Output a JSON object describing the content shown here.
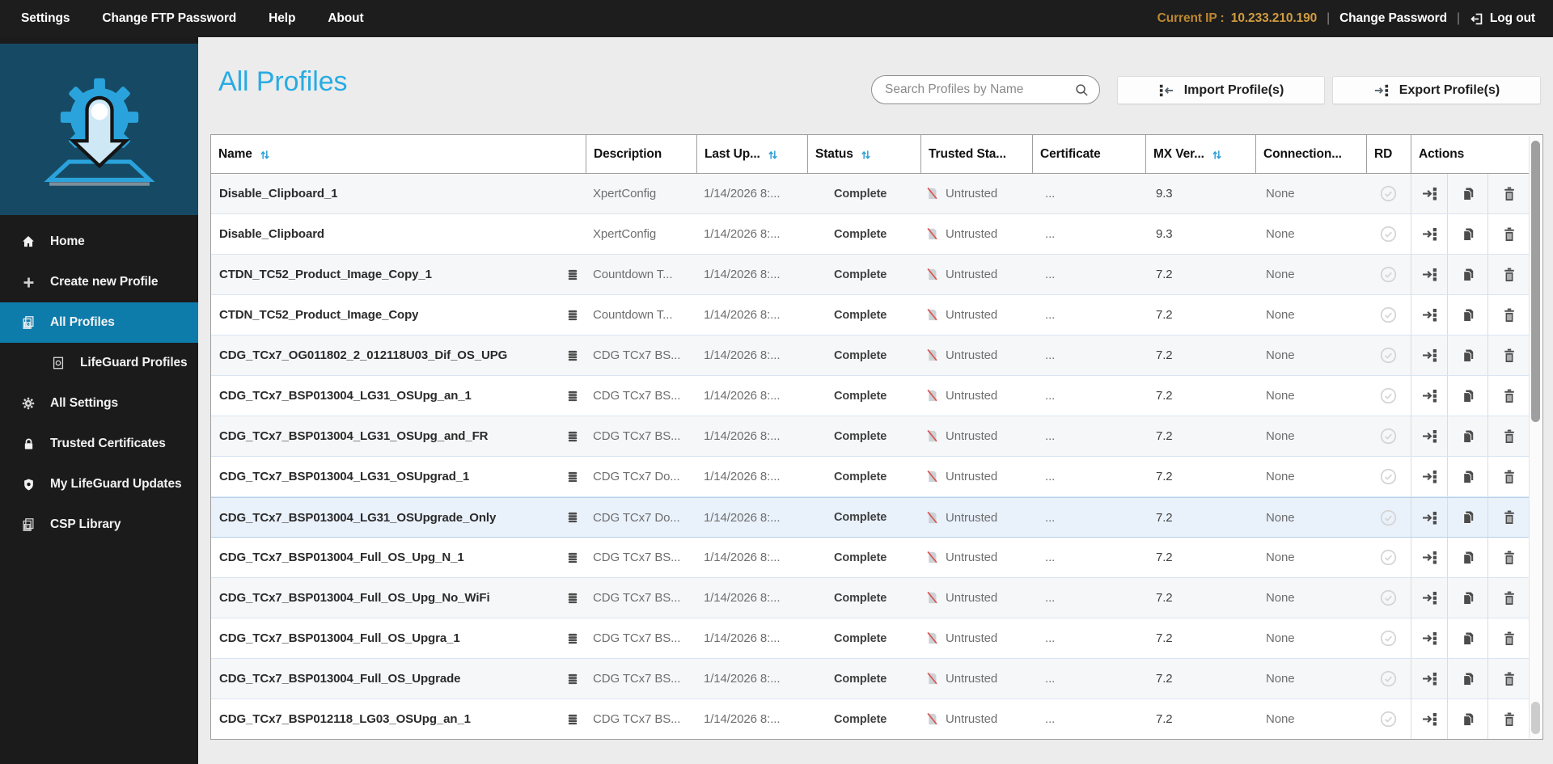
{
  "topbar": {
    "menu": [
      "Settings",
      "Change FTP Password",
      "Help",
      "About"
    ],
    "current_ip_label": "Current IP :",
    "current_ip": "10.233.210.190",
    "change_password": "Change Password",
    "logout": "Log out"
  },
  "sidebar": {
    "items": [
      {
        "label": "Home",
        "icon": "home-icon",
        "selected": false,
        "indent": false
      },
      {
        "label": "Create new Profile",
        "icon": "plus-icon",
        "selected": false,
        "indent": false
      },
      {
        "label": "All Profiles",
        "icon": "profile-doc-icon",
        "selected": true,
        "indent": false
      },
      {
        "label": "LifeGuard Profiles",
        "icon": "lifeguard-doc-icon",
        "selected": false,
        "indent": true
      },
      {
        "label": "All Settings",
        "icon": "gear-icon",
        "selected": false,
        "indent": false
      },
      {
        "label": "Trusted Certificates",
        "icon": "lock-icon",
        "selected": false,
        "indent": false
      },
      {
        "label": "My LifeGuard Updates",
        "icon": "shield-icon",
        "selected": false,
        "indent": false
      },
      {
        "label": "CSP Library",
        "icon": "csp-doc-icon",
        "selected": false,
        "indent": false
      }
    ]
  },
  "header": {
    "title": "All Profiles",
    "search_placeholder": "Search Profiles by Name",
    "import_label": "Import Profile(s)",
    "export_label": "Export Profile(s)"
  },
  "table": {
    "columns": [
      {
        "label": "Name",
        "sortable": true
      },
      {
        "label": "Description",
        "sortable": false
      },
      {
        "label": "Last Up...",
        "sortable": true
      },
      {
        "label": "Status",
        "sortable": true
      },
      {
        "label": "Trusted Sta...",
        "sortable": false
      },
      {
        "label": "Certificate",
        "sortable": false
      },
      {
        "label": "MX Ver...",
        "sortable": true
      },
      {
        "label": "Connection...",
        "sortable": false
      },
      {
        "label": "RD",
        "sortable": false
      },
      {
        "label": "Actions",
        "sortable": false
      }
    ],
    "rows": [
      {
        "name": "Disable_Clipboard_1",
        "has_package_icon": false,
        "description": "XpertConfig",
        "last_updated": "1/14/2026 8:...",
        "status": "Complete",
        "trusted_status": "Untrusted",
        "certificate": "...",
        "mx_version": "9.3",
        "connection": "None",
        "highlighted": false
      },
      {
        "name": "Disable_Clipboard",
        "has_package_icon": false,
        "description": "XpertConfig",
        "last_updated": "1/14/2026 8:...",
        "status": "Complete",
        "trusted_status": "Untrusted",
        "certificate": "...",
        "mx_version": "9.3",
        "connection": "None",
        "highlighted": false
      },
      {
        "name": "CTDN_TC52_Product_Image_Copy_1",
        "has_package_icon": true,
        "description": "Countdown T...",
        "last_updated": "1/14/2026 8:...",
        "status": "Complete",
        "trusted_status": "Untrusted",
        "certificate": "...",
        "mx_version": "7.2",
        "connection": "None",
        "highlighted": false
      },
      {
        "name": "CTDN_TC52_Product_Image_Copy",
        "has_package_icon": true,
        "description": "Countdown T...",
        "last_updated": "1/14/2026 8:...",
        "status": "Complete",
        "trusted_status": "Untrusted",
        "certificate": "...",
        "mx_version": "7.2",
        "connection": "None",
        "highlighted": false
      },
      {
        "name": "CDG_TCx7_OG011802_2_012118U03_Dif_OS_UPG",
        "has_package_icon": true,
        "description": "CDG TCx7 BS...",
        "last_updated": "1/14/2026 8:...",
        "status": "Complete",
        "trusted_status": "Untrusted",
        "certificate": "...",
        "mx_version": "7.2",
        "connection": "None",
        "highlighted": false
      },
      {
        "name": "CDG_TCx7_BSP013004_LG31_OSUpg_an_1",
        "has_package_icon": true,
        "description": "CDG TCx7 BS...",
        "last_updated": "1/14/2026 8:...",
        "status": "Complete",
        "trusted_status": "Untrusted",
        "certificate": "...",
        "mx_version": "7.2",
        "connection": "None",
        "highlighted": false
      },
      {
        "name": "CDG_TCx7_BSP013004_LG31_OSUpg_and_FR",
        "has_package_icon": true,
        "description": "CDG TCx7 BS...",
        "last_updated": "1/14/2026 8:...",
        "status": "Complete",
        "trusted_status": "Untrusted",
        "certificate": "...",
        "mx_version": "7.2",
        "connection": "None",
        "highlighted": false
      },
      {
        "name": "CDG_TCx7_BSP013004_LG31_OSUpgrad_1",
        "has_package_icon": true,
        "description": "CDG TCx7 Do...",
        "last_updated": "1/14/2026 8:...",
        "status": "Complete",
        "trusted_status": "Untrusted",
        "certificate": "...",
        "mx_version": "7.2",
        "connection": "None",
        "highlighted": false
      },
      {
        "name": "CDG_TCx7_BSP013004_LG31_OSUpgrade_Only",
        "has_package_icon": true,
        "description": "CDG TCx7 Do...",
        "last_updated": "1/14/2026 8:...",
        "status": "Complete",
        "trusted_status": "Untrusted",
        "certificate": "...",
        "mx_version": "7.2",
        "connection": "None",
        "highlighted": true
      },
      {
        "name": "CDG_TCx7_BSP013004_Full_OS_Upg_N_1",
        "has_package_icon": true,
        "description": "CDG TCx7 BS...",
        "last_updated": "1/14/2026 8:...",
        "status": "Complete",
        "trusted_status": "Untrusted",
        "certificate": "...",
        "mx_version": "7.2",
        "connection": "None",
        "highlighted": false
      },
      {
        "name": "CDG_TCx7_BSP013004_Full_OS_Upg_No_WiFi",
        "has_package_icon": true,
        "description": "CDG TCx7 BS...",
        "last_updated": "1/14/2026 8:...",
        "status": "Complete",
        "trusted_status": "Untrusted",
        "certificate": "...",
        "mx_version": "7.2",
        "connection": "None",
        "highlighted": false
      },
      {
        "name": "CDG_TCx7_BSP013004_Full_OS_Upgra_1",
        "has_package_icon": true,
        "description": "CDG TCx7 BS...",
        "last_updated": "1/14/2026 8:...",
        "status": "Complete",
        "trusted_status": "Untrusted",
        "certificate": "...",
        "mx_version": "7.2",
        "connection": "None",
        "highlighted": false
      },
      {
        "name": "CDG_TCx7_BSP013004_Full_OS_Upgrade",
        "has_package_icon": true,
        "description": "CDG TCx7 BS...",
        "last_updated": "1/14/2026 8:...",
        "status": "Complete",
        "trusted_status": "Untrusted",
        "certificate": "...",
        "mx_version": "7.2",
        "connection": "None",
        "highlighted": false
      },
      {
        "name": "CDG_TCx7_BSP012118_LG03_OSUpg_an_1",
        "has_package_icon": true,
        "description": "CDG TCx7 BS...",
        "last_updated": "1/14/2026 8:...",
        "status": "Complete",
        "trusted_status": "Untrusted",
        "certificate": "...",
        "mx_version": "7.2",
        "connection": "None",
        "highlighted": false
      }
    ]
  },
  "colors": {
    "accent_blue": "#29abe2",
    "selected_nav": "#0e7cab",
    "logo_panel": "#164a64",
    "topbar_bg": "#1d1d1d",
    "ip_orange": "#c8923a",
    "untrusted_red": "#d9534f",
    "row_highlight": "#e9f1fb"
  }
}
